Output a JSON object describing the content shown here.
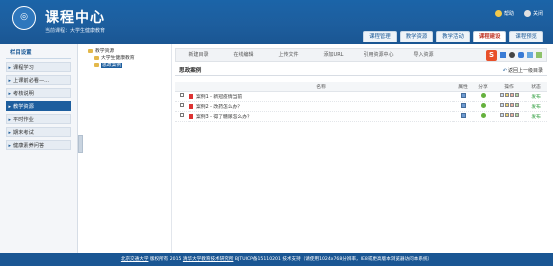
{
  "header": {
    "logo_glyph": "◎",
    "title": "课程中心",
    "current_course_label": "当前课程：",
    "current_course": "大学生健康教育",
    "help": "帮助",
    "user": "关闭"
  },
  "nav_tabs": [
    "课程管理",
    "教学资源",
    "教学活动",
    "课程建设",
    "课程预览"
  ],
  "sidebar": {
    "heading": "栏目设置",
    "items": [
      "课程学习",
      "上课前必看—...",
      "考核说明",
      "教学资源",
      "平时作业",
      "期末考试",
      "健康素养问答"
    ],
    "active_index": 3
  },
  "tree": {
    "root": "教学资源",
    "child": "大学生健康教育",
    "leaf": "思政案例"
  },
  "toolbar": {
    "buttons": [
      "新建目录",
      "在线编辑",
      "上传文件",
      "添加URL",
      "引用资源中心",
      "导入资源"
    ]
  },
  "section": {
    "title": "思政案例",
    "back_label": "返回上一级目录"
  },
  "table": {
    "headers": [
      "名称",
      "属性",
      "分享",
      "操作",
      "状态"
    ],
    "rows": [
      {
        "name": "案例1 - 新冠疫情当前",
        "status": "发布"
      },
      {
        "name": "案例2 - 改药怎么办？",
        "status": "发布"
      },
      {
        "name": "案例3 - 得了糖尿怎么办？",
        "status": "发布"
      }
    ]
  },
  "footer": {
    "school": "北京交通大学",
    "copyright": " 版权所有 2015 ",
    "support": "清华大学教育技术研究所",
    "rest": " BJTUICP备15110201 技术支持（请使用1024x768分辨率，IE8或更高版本浏览器访问本系统）"
  },
  "colors": {
    "brand": "#1d5e9e",
    "status_green": "#2c9c3c",
    "tab_active_text": "#c0392b"
  }
}
